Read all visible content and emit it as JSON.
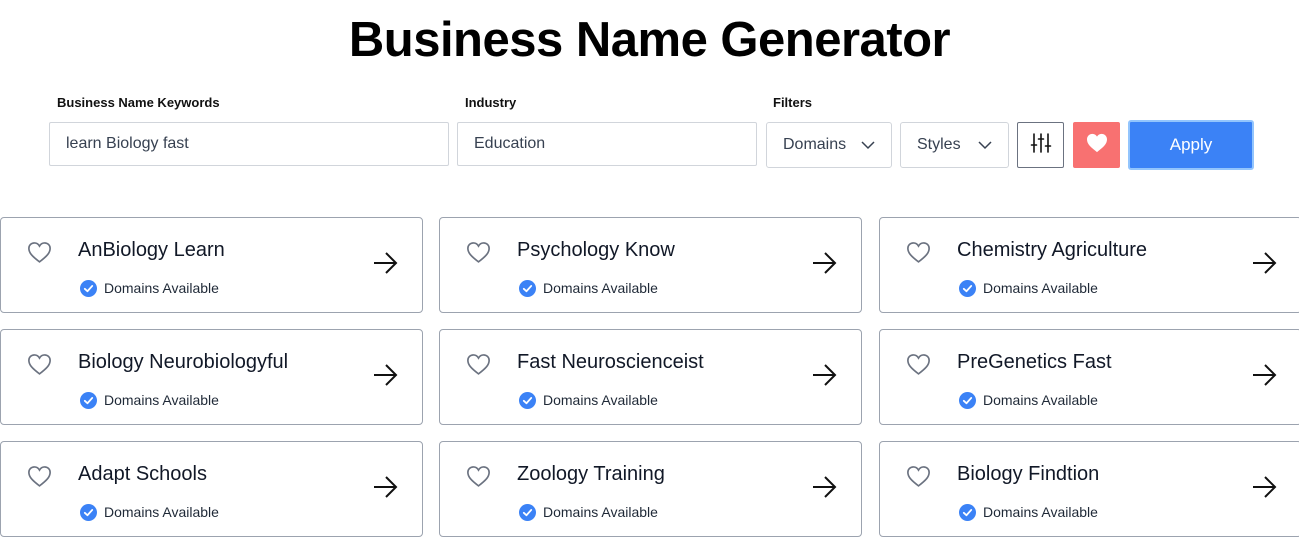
{
  "title": "Business Name Generator",
  "form": {
    "keywords_label": "Business Name Keywords",
    "keywords_value": "learn Biology fast",
    "industry_label": "Industry",
    "industry_value": "Education",
    "filters_label": "Filters",
    "domains_select": "Domains",
    "styles_select": "Styles",
    "apply_label": "Apply"
  },
  "icons": {
    "advanced_filters": "sliders-icon",
    "favorites": "heart-filled-icon",
    "favorite_toggle": "heart-outline-icon",
    "status": "check-circle-icon",
    "open": "arrow-right-icon",
    "dropdown": "chevron-down-icon"
  },
  "colors": {
    "apply_bg": "#3b82f6",
    "favorites_bg": "#f87171",
    "check_badge": "#3b82f6"
  },
  "results": [
    {
      "name": "AnBiology Learn",
      "status": "Domains Available"
    },
    {
      "name": "Psychology Know",
      "status": "Domains Available"
    },
    {
      "name": "Chemistry Agriculture",
      "status": "Domains Available"
    },
    {
      "name": "Biology Neurobiologyful",
      "status": "Domains Available"
    },
    {
      "name": "Fast Neuroscienceist",
      "status": "Domains Available"
    },
    {
      "name": "PreGenetics Fast",
      "status": "Domains Available"
    },
    {
      "name": "Adapt Schools",
      "status": "Domains Available"
    },
    {
      "name": "Zoology Training",
      "status": "Domains Available"
    },
    {
      "name": "Biology Findtion",
      "status": "Domains Available"
    }
  ]
}
